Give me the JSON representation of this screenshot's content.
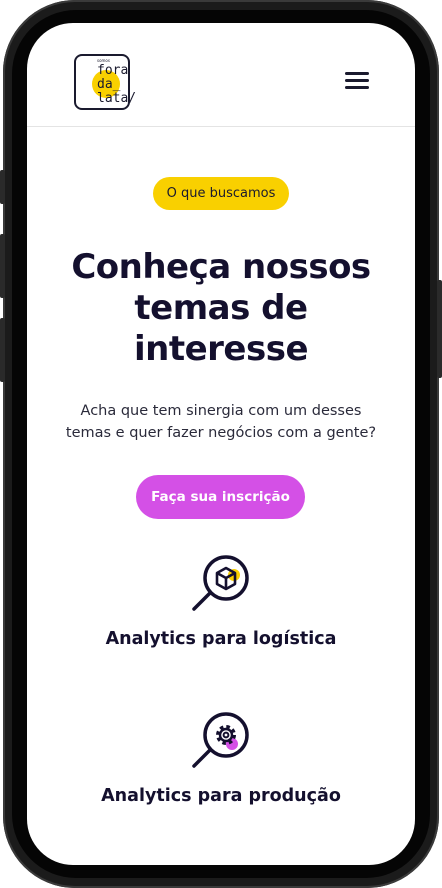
{
  "header": {
    "logo": {
      "small_text": "somos",
      "line1": "fora",
      "line2": "da_",
      "line3": "lata/",
      "accent_color": "#f9d000"
    },
    "menu_icon": "hamburger-menu-icon"
  },
  "hero": {
    "badge": "O que buscamos",
    "title": "Conheça nossos temas de interesse",
    "subtitle": "Acha que tem sinergia com um desses temas e quer fazer negócios com a gente?",
    "cta": "Faça sua inscrição"
  },
  "topics": [
    {
      "label": "Analytics para logística",
      "icon": "magnifier-box-icon"
    },
    {
      "label": "Analytics para produção",
      "icon": "magnifier-gear-icon"
    }
  ],
  "colors": {
    "badge": "#f9d000",
    "cta": "#d450e6",
    "text": "#14102e"
  }
}
